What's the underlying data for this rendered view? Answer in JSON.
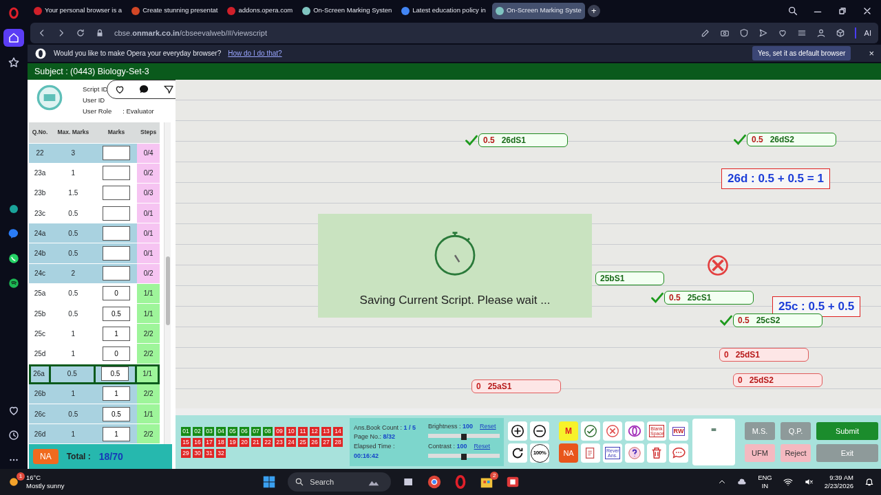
{
  "browser": {
    "tabs": [
      {
        "title": "Your personal browser is a",
        "selected": false,
        "color": "#d0202a"
      },
      {
        "title": "Create stunning presentat",
        "selected": false,
        "color": "#d24726"
      },
      {
        "title": "addons.opera.com",
        "selected": false,
        "color": "#d0202a"
      },
      {
        "title": "On-Screen Marking Systen",
        "selected": false,
        "color": "#7fc4c0"
      },
      {
        "title": "Latest education policy in",
        "selected": false,
        "color": "#4285f4"
      },
      {
        "title": "On-Screen Marking Syste",
        "selected": true,
        "color": "#7fc4c0"
      }
    ],
    "new_tab": "+",
    "address": "cbse.**onmark.co.in**/cbseevalweb/#/viewscript",
    "ai_label": "AI",
    "infobar": {
      "question": "Would you like to make Opera your everyday browser?",
      "link": "How do I do that?",
      "button": "Yes, set it as default browser",
      "close": "×"
    }
  },
  "app": {
    "subject": "Subject : (0443) Biology-Set-3",
    "script_info": {
      "script_id_label": "Script ID",
      "user_id_label": "User ID",
      "user_role_label": "User Role",
      "user_role": ": Evaluator"
    },
    "table": {
      "columns": [
        "Q.No.",
        "Max. Marks",
        "Marks",
        "Steps"
      ],
      "rows": [
        {
          "qno": "22",
          "max": "3",
          "steps": "0/4",
          "steps_done": false,
          "shaded": true,
          "selected": false
        },
        {
          "qno": "23a",
          "max": "1",
          "steps": "0/2",
          "steps_done": false,
          "shaded": false,
          "selected": false
        },
        {
          "qno": "23b",
          "max": "1.5",
          "steps": "0/3",
          "steps_done": false,
          "shaded": false,
          "selected": false
        },
        {
          "qno": "23c",
          "max": "0.5",
          "steps": "0/1",
          "steps_done": false,
          "shaded": false,
          "selected": false
        },
        {
          "qno": "24a",
          "max": "0.5",
          "steps": "0/1",
          "steps_done": false,
          "shaded": true,
          "selected": false
        },
        {
          "qno": "24b",
          "max": "0.5",
          "steps": "0/1",
          "steps_done": false,
          "shaded": true,
          "selected": false
        },
        {
          "qno": "24c",
          "max": "2",
          "steps": "0/2",
          "steps_done": false,
          "shaded": true,
          "selected": false
        },
        {
          "qno": "25a",
          "max": "0.5",
          "marks": "0",
          "steps": "1/1",
          "steps_done": true,
          "shaded": false,
          "selected": false
        },
        {
          "qno": "25b",
          "max": "0.5",
          "marks": "0.5",
          "steps": "1/1",
          "steps_done": true,
          "shaded": false,
          "selected": false
        },
        {
          "qno": "25c",
          "max": "1",
          "marks": "1",
          "steps": "2/2",
          "steps_done": true,
          "shaded": false,
          "selected": false
        },
        {
          "qno": "25d",
          "max": "1",
          "marks": "0",
          "steps": "2/2",
          "steps_done": true,
          "shaded": false,
          "selected": false
        },
        {
          "qno": "26a",
          "max": "0.5",
          "marks": "0.5",
          "steps": "1/1",
          "steps_done": true,
          "shaded": true,
          "selected": true
        },
        {
          "qno": "26b",
          "max": "1",
          "marks": "1",
          "steps": "2/2",
          "steps_done": true,
          "shaded": true,
          "selected": false
        },
        {
          "qno": "26c",
          "max": "0.5",
          "marks": "0.5",
          "steps": "1/1",
          "steps_done": true,
          "shaded": true,
          "selected": false
        },
        {
          "qno": "26d",
          "max": "1",
          "marks": "1",
          "steps": "2/2",
          "steps_done": true,
          "shaded": true,
          "selected": false
        }
      ]
    },
    "na_button": "NA",
    "total_label": "Total :",
    "total": "18/70",
    "annotations": [
      {
        "kind": "awarded",
        "value": "0.5",
        "label": "26dS1"
      },
      {
        "kind": "awarded",
        "value": "0.5",
        "label": "26dS2"
      },
      {
        "kind": "sum",
        "label": "26d : 0.5 + 0.5 = 1"
      },
      {
        "kind": "cross"
      },
      {
        "kind": "partial",
        "label": "25bS1"
      },
      {
        "kind": "awarded",
        "value": "0.5",
        "label": "25cS1"
      },
      {
        "kind": "sum",
        "label": "25c : 0.5 + 0.5"
      },
      {
        "kind": "awarded",
        "value": "0.5",
        "label": "25cS2"
      },
      {
        "kind": "zero",
        "value": "0",
        "label": "25dS1"
      },
      {
        "kind": "zero",
        "value": "0",
        "label": "25dS2"
      },
      {
        "kind": "zero",
        "value": "0",
        "label": "25aS1"
      }
    ],
    "saving_message": "Saving Current Script. Please wait ...",
    "pages": [
      {
        "label": "01",
        "done": true
      },
      {
        "label": "02",
        "done": true
      },
      {
        "label": "03",
        "done": true
      },
      {
        "label": "04",
        "done": true
      },
      {
        "label": "05",
        "done": true
      },
      {
        "label": "06",
        "done": true
      },
      {
        "label": "07",
        "done": true
      },
      {
        "label": "08",
        "done": true
      },
      {
        "label": "09",
        "done": false
      },
      {
        "label": "10",
        "done": false
      },
      {
        "label": "11",
        "done": false
      },
      {
        "label": "12",
        "done": false
      },
      {
        "label": "13",
        "done": false
      },
      {
        "label": "14",
        "done": false
      },
      {
        "label": "15",
        "done": false
      },
      {
        "label": "16",
        "done": false
      },
      {
        "label": "17",
        "done": false
      },
      {
        "label": "18",
        "done": false
      },
      {
        "label": "19",
        "done": false
      },
      {
        "label": "20",
        "done": false
      },
      {
        "label": "21",
        "done": false
      },
      {
        "label": "22",
        "done": false
      },
      {
        "label": "23",
        "done": false
      },
      {
        "label": "24",
        "done": false
      },
      {
        "label": "25",
        "done": false
      },
      {
        "label": "26",
        "done": false
      },
      {
        "label": "27",
        "done": false
      },
      {
        "label": "28",
        "done": false
      },
      {
        "label": "29",
        "done": false
      },
      {
        "label": "30",
        "done": false
      },
      {
        "label": "31",
        "done": false
      },
      {
        "label": "32",
        "done": false
      }
    ],
    "stats": [
      {
        "label": "Ans.Book Count :",
        "value": "1 / 5"
      },
      {
        "label": "Page No.:",
        "value": "8/32"
      },
      {
        "label": "Elapsed Time :",
        "value": "00:16:42"
      }
    ],
    "sliders": [
      {
        "label": "Brightness :",
        "value": "100",
        "reset": "Reset",
        "level": 0.5
      },
      {
        "label": "Contrast :",
        "value": "100",
        "reset": "Reset",
        "level": 0.5
      }
    ],
    "zoom_label": "100%",
    "tool_labels": {
      "mark": "M",
      "blank_space": "Blank Space",
      "rw": "RW",
      "na": "NA",
      "revert": "Rever Ans."
    },
    "actions": [
      {
        "label": "M.S.",
        "kind": "grey"
      },
      {
        "label": "Q.P.",
        "kind": "grey"
      },
      {
        "label": "Submit",
        "kind": "primary"
      },
      {
        "label": "UFM",
        "kind": "pink"
      },
      {
        "label": "Reject",
        "kind": "pink"
      },
      {
        "label": "Exit",
        "kind": "grey"
      }
    ]
  },
  "taskbar": {
    "weather_badge": "1",
    "temperature": "16°C",
    "weather": "Mostly sunny",
    "search": "Search",
    "app_badge": "2",
    "lang": "ENG",
    "region": "IN",
    "time": "9:39 AM",
    "date": "2/23/2026"
  }
}
